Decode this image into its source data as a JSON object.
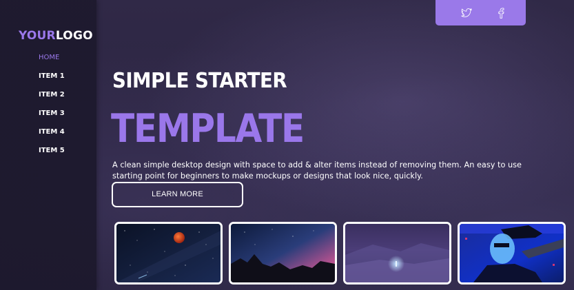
{
  "logo": {
    "accent": "YOUR",
    "rest": "LOGO"
  },
  "nav": {
    "items": [
      {
        "label": "HOME",
        "active": true
      },
      {
        "label": "ITEM 1"
      },
      {
        "label": "ITEM 2"
      },
      {
        "label": "ITEM 3"
      },
      {
        "label": "ITEM 4"
      },
      {
        "label": "ITEM 5"
      }
    ]
  },
  "social": {
    "icons": [
      "twitter-icon",
      "facebook-icon"
    ]
  },
  "hero": {
    "headline": "SIMPLE STARTER",
    "title": "TEMPLATE",
    "description": "A clean simple desktop design with space to add & alter items instead of removing them. An easy to use starting point for beginners to make mockups or designs that look nice, quickly.",
    "cta_label": "LEARN MORE"
  },
  "colors": {
    "accent": "#9a78ea",
    "sidebar": "#1e1a2e",
    "background": "#2b2441",
    "text": "#ffffff"
  },
  "gallery": {
    "cards": [
      {
        "subject": "red-moon-milky-way"
      },
      {
        "subject": "mountain-silhouette-starry-sky"
      },
      {
        "subject": "snowy-hill-night-figure"
      },
      {
        "subject": "neon-cyber-portrait"
      }
    ]
  }
}
